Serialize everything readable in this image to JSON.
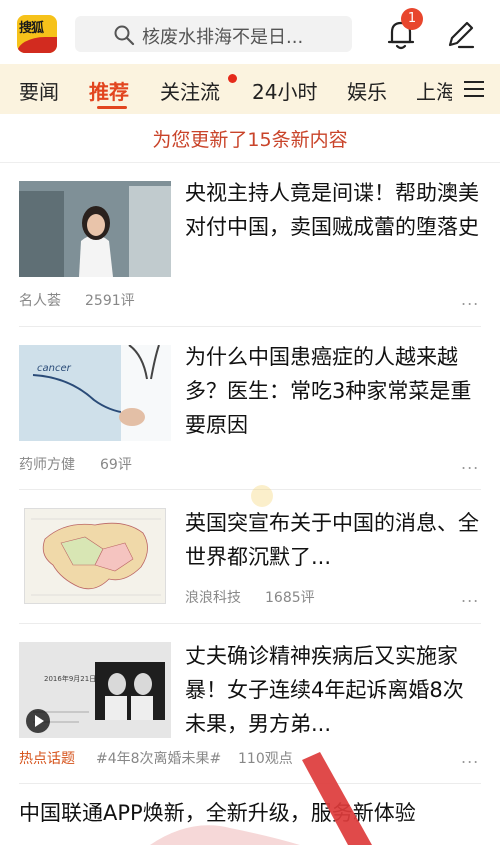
{
  "header": {
    "logo_text": "搜狐",
    "search_placeholder": "核废水排海不是日...",
    "notification_count": "1"
  },
  "tabs": [
    {
      "label": "要闻"
    },
    {
      "label": "推荐"
    },
    {
      "label": "关注流"
    },
    {
      "label": "24小时"
    },
    {
      "label": "娱乐"
    },
    {
      "label": "上海"
    }
  ],
  "notice": "为您更新了15条新内容",
  "articles": [
    {
      "title": "央视主持人竟是间谍！帮助澳美对付中国，卖国贼成蕾的堕落史",
      "source": "名人荟",
      "comments": "2591评"
    },
    {
      "title": "为什么中国患癌症的人越来越多？医生：常吃3种家常菜是重要原因",
      "source": "药师方健",
      "comments": "69评",
      "thumb_text": "cancer"
    },
    {
      "title": "英国突宣布关于中国的消息、全世界都沉默了...",
      "source": "浪浪科技",
      "comments": "1685评"
    },
    {
      "title": "丈夫确诊精神疾病后又实施家暴！女子连续4年起诉离婚8次未果，男方弟...",
      "tag": "热点话题",
      "topic": "#4年8次离婚未果#",
      "views": "110观点",
      "thumb_date": "2016年9月21日"
    }
  ],
  "more_label": "...",
  "next_article": {
    "title": "中国联通APP焕新，全新升级，服务新体验"
  }
}
